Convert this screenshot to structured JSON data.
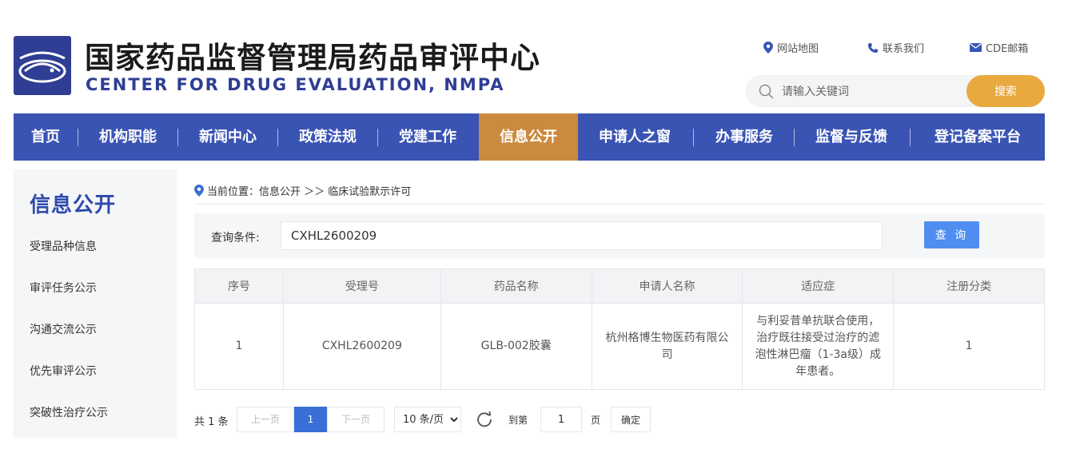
{
  "header": {
    "title_cn": "国家药品监督管理局药品审评中心",
    "title_en": "CENTER FOR DRUG EVALUATION, NMPA",
    "top_links": {
      "sitemap": "网站地图",
      "contact": "联系我们",
      "mail": "CDE邮箱"
    },
    "search": {
      "placeholder": "请输入关键词",
      "button": "搜索"
    }
  },
  "nav": {
    "items": [
      "首页",
      "机构职能",
      "新闻中心",
      "政策法规",
      "党建工作",
      "信息公开",
      "申请人之窗",
      "办事服务",
      "监督与反馈",
      "登记备案平台"
    ],
    "active": "信息公开"
  },
  "sidebar": {
    "title": "信息公开",
    "items": [
      "受理品种信息",
      "审评任务公示",
      "沟通交流公示",
      "优先审评公示",
      "突破性治疗公示"
    ]
  },
  "breadcrumb": {
    "prefix": "当前位置：信息公开 ＞＞ 临床试验默示许可"
  },
  "query": {
    "label": "查询条件:",
    "value": "CXHL2600209",
    "button": "查 询"
  },
  "table": {
    "headers": [
      "序号",
      "受理号",
      "药品名称",
      "申请人名称",
      "适应症",
      "注册分类"
    ],
    "rows": [
      [
        "1",
        "CXHL2600209",
        "GLB-002胶囊",
        "杭州格博生物医药有限公司",
        "与利妥昔单抗联合使用，治疗既往接受过治疗的滤泡性淋巴瘤（1-3a级）成年患者。",
        "1"
      ]
    ]
  },
  "pager": {
    "total": "共 1 条",
    "prev": "上一页",
    "current": "1",
    "next": "下一页",
    "size": "10 条/页",
    "goto_label": "到第",
    "goto_value": "1",
    "page_label": "页",
    "confirm": "确定"
  },
  "colors": {
    "brand": "#3a54b4",
    "active_nav": "#cc8a3f",
    "search_btn": "#e8a93e",
    "query_btn": "#4f8ef0",
    "current_page": "#3a6fd8"
  }
}
